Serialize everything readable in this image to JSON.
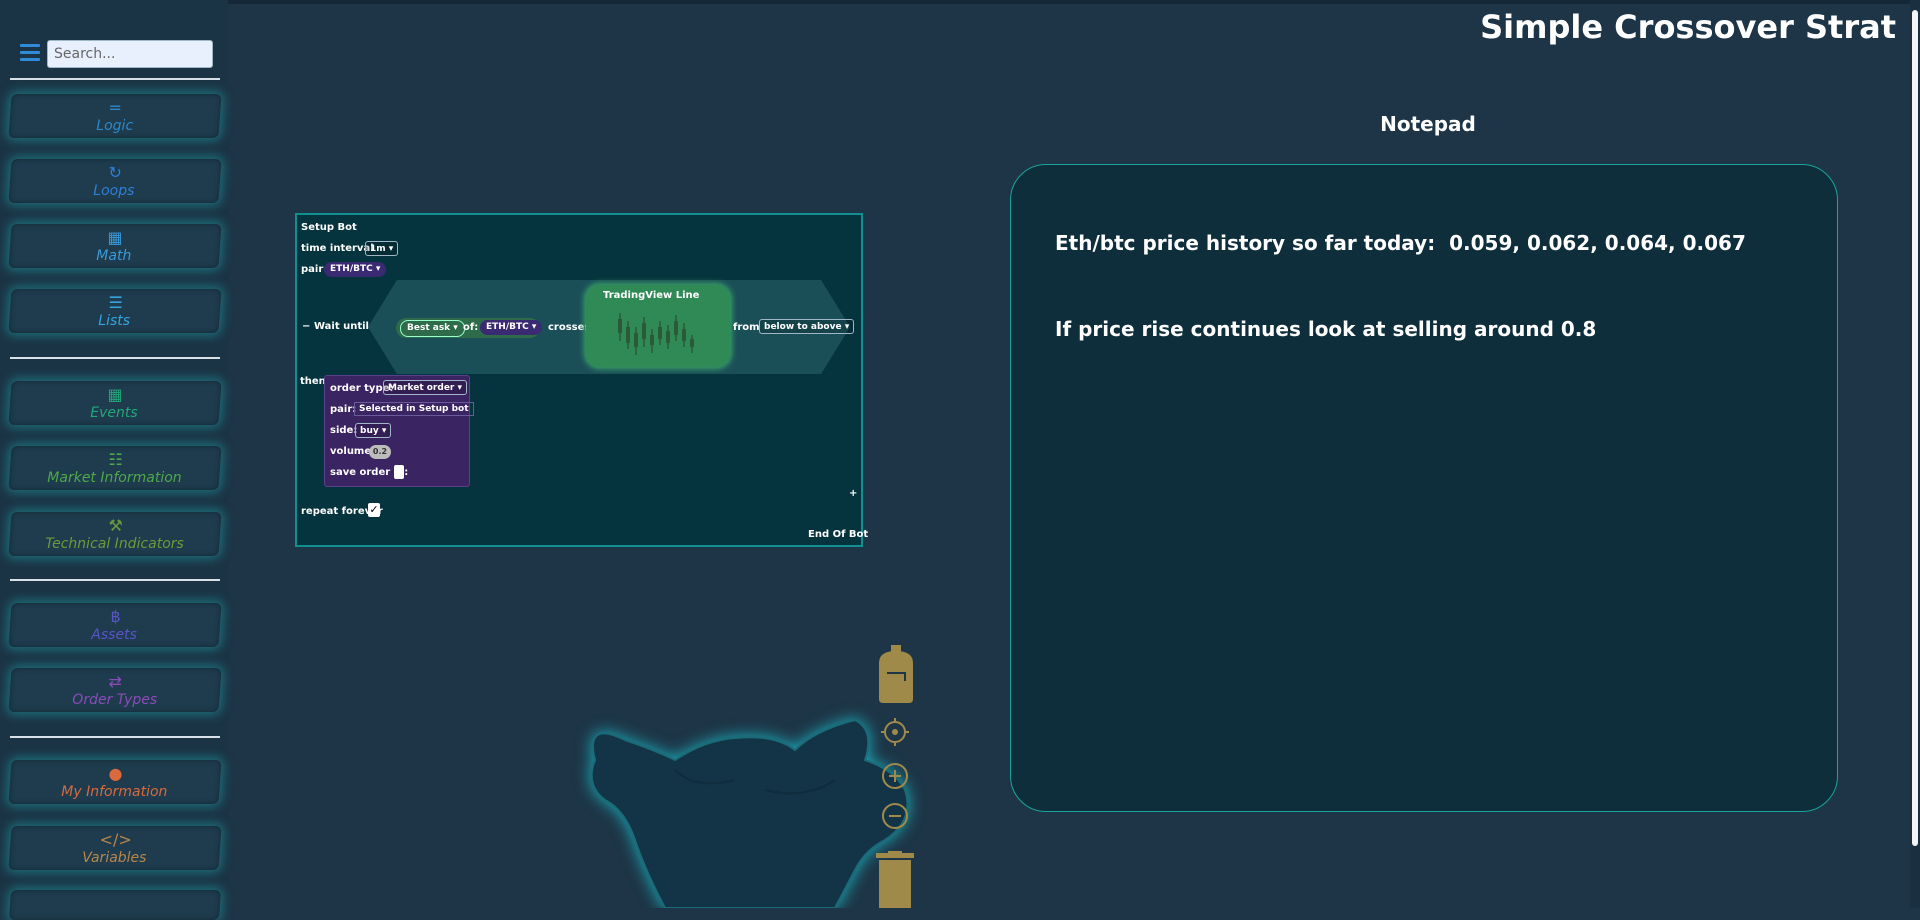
{
  "header": {
    "title": "Simple Crossover Strat"
  },
  "sidebar": {
    "search": {
      "placeholder": "Search..."
    },
    "categories": [
      {
        "label": "Logic",
        "icon": "equals-icon",
        "glyph": "=",
        "color": "#2e88c8"
      },
      {
        "label": "Loops",
        "icon": "loop-icon",
        "glyph": "↻",
        "color": "#2e7fd6"
      },
      {
        "label": "Math",
        "icon": "calculator-icon",
        "glyph": "▦",
        "color": "#3a9ad9"
      },
      {
        "label": "Lists",
        "icon": "list-icon",
        "glyph": "☰",
        "color": "#36a3dd"
      },
      {
        "label": "Events",
        "icon": "calendar-icon",
        "glyph": "▦",
        "color": "#23a77a"
      },
      {
        "label": "Market Information",
        "icon": "chart-icon",
        "glyph": "☷",
        "color": "#4ea84a"
      },
      {
        "label": "Technical Indicators",
        "icon": "wrench-icon",
        "glyph": "⚒",
        "color": "#6b9a3a"
      },
      {
        "label": "Assets",
        "icon": "bitcoin-icon",
        "glyph": "฿",
        "color": "#5b53c9"
      },
      {
        "label": "Order Types",
        "icon": "arrows-icon",
        "glyph": "⇄",
        "color": "#8a4bb8"
      },
      {
        "label": "My Information",
        "icon": "user-icon",
        "glyph": "●",
        "color": "#d86a3c"
      },
      {
        "label": "Variables",
        "icon": "code-icon",
        "glyph": "</>",
        "color": "#b8864a"
      }
    ]
  },
  "workspace": {
    "setup_bot": {
      "title": "Setup Bot",
      "time_interval_label": "time interval",
      "time_interval_value": "1m",
      "pair_label": "pair",
      "pair_value": "ETH/BTC"
    },
    "wait_until": {
      "collapse": "−",
      "label": "Wait until",
      "price_type": "Best ask",
      "of_label": "of:",
      "of_value": "ETH/BTC",
      "crosses_label": "crosses",
      "tv_line_title": "TradingView Line",
      "from_label": "from",
      "direction": "below to above"
    },
    "then_block": {
      "then_label": "then",
      "order_type_label": "order type:",
      "order_type_value": "Market order",
      "pair_label": "pair:",
      "pair_value": "Selected in Setup bot",
      "side_label": "side:",
      "side_value": "buy",
      "volume_label": "volume",
      "volume_value": "0.2",
      "save_order_id_label": "save order id:"
    },
    "footer": {
      "plus": "+",
      "repeat_forever_label": "repeat forever",
      "repeat_checked": "✓",
      "end_label": "End Of Bot"
    }
  },
  "notepad": {
    "title": "Notepad",
    "lines": [
      "Eth/btc price history so far today:  0.059, 0.062, 0.064, 0.067",
      "If price rise continues look at selling around 0.8"
    ]
  },
  "tools": {
    "backpack_icon": "backpack-icon",
    "recenter_icon": "crosshair-icon",
    "zoom_in_icon": "zoom-in-icon",
    "zoom_out_icon": "zoom-out-icon",
    "trash_icon": "trash-icon",
    "tool_color": "#a08a4a"
  }
}
